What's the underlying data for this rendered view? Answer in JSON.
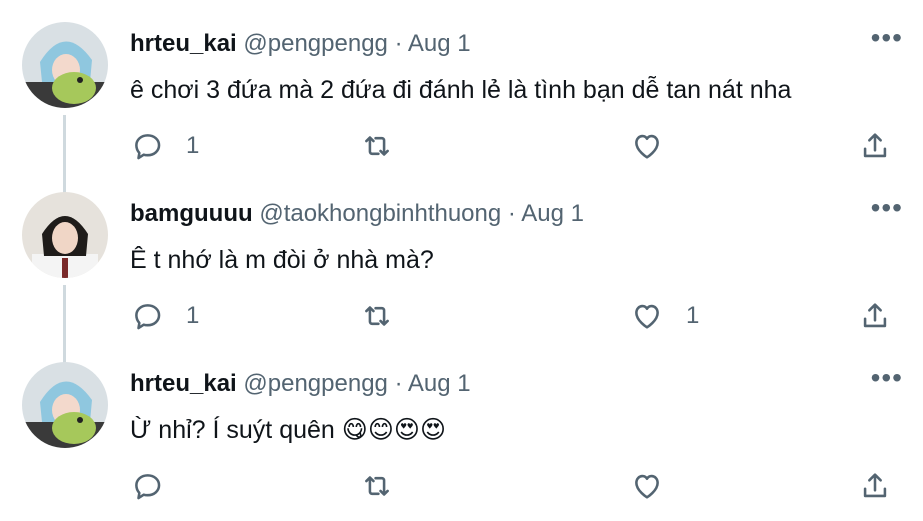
{
  "tweets": [
    {
      "name": "hrteu_kai",
      "handle": "@pengpengg",
      "separator": "·",
      "date": "Aug 1",
      "text": "ê chơi 3 đứa mà 2 đứa đi đánh lẻ là tình bạn dễ tan nát nha",
      "emojis": [],
      "reply_count": "1",
      "retweet_count": "",
      "like_count": ""
    },
    {
      "name": "bamguuuu",
      "handle": "@taokhongbinhthuong",
      "separator": "·",
      "date": "Aug 1",
      "text": "Ê t nhớ là m đòi ở nhà mà?",
      "emojis": [],
      "reply_count": "1",
      "retweet_count": "",
      "like_count": "1"
    },
    {
      "name": "hrteu_kai",
      "handle": "@pengpengg",
      "separator": "·",
      "date": "Aug 1",
      "text": "Ừ nhỉ? Í suýt quên ",
      "emojis": [
        "😋",
        "😊",
        "😍",
        "😍"
      ],
      "reply_count": "",
      "retweet_count": "",
      "like_count": ""
    }
  ],
  "more_label": "•••",
  "icons": {
    "reply": "reply-icon",
    "retweet": "retweet-icon",
    "like": "heart-icon",
    "share": "share-icon",
    "more": "more-icon"
  },
  "colors": {
    "text": "#0f1419",
    "secondary": "#536471",
    "thread_line": "#cfd9de"
  }
}
